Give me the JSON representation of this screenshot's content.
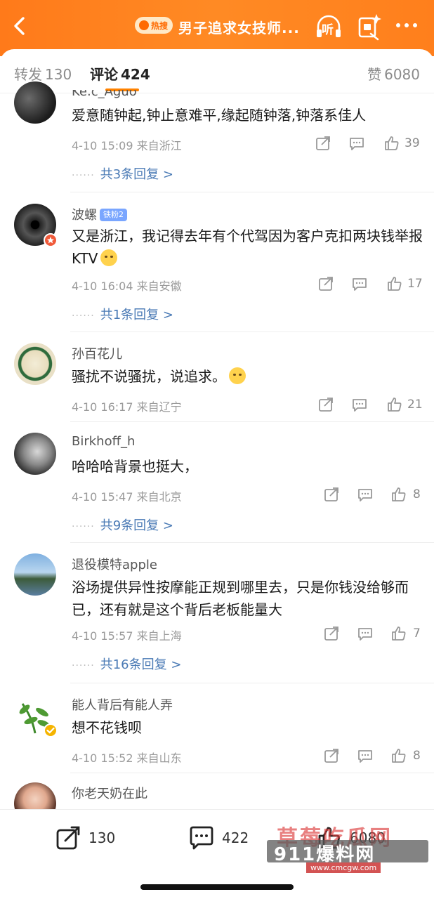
{
  "header": {
    "hot_badge": "热搜",
    "title": "男子追求女技师...",
    "listen_label": "听"
  },
  "tabs": {
    "repost_label": "转发",
    "repost_count": "130",
    "comments_label": "评论",
    "comments_count": "424",
    "likes_label": "赞",
    "likes_count": "6080"
  },
  "comments": [
    {
      "username": "Ke.c_Aguo",
      "text": "爱意随钟起,钟止意难平,缘起随钟落,钟落系佳人",
      "time": "4-10 15:09",
      "location": "来自浙江",
      "likes": "39",
      "replies": "共3条回复 >"
    },
    {
      "username": "波螺",
      "badge": "铁粉2",
      "text": "又是浙江，我记得去年有个代驾因为客户克扣两块钱举报KTV",
      "time": "4-10 16:04",
      "location": "来自安徽",
      "likes": "17",
      "replies": "共1条回复 >"
    },
    {
      "username": "孙百花儿",
      "text": "骚扰不说骚扰，说追求。",
      "time": "4-10 16:17",
      "location": "来自辽宁",
      "likes": "21"
    },
    {
      "username": "Birkhoff_h",
      "text": "哈哈哈背景也挺大，",
      "time": "4-10 15:47",
      "location": "来自北京",
      "likes": "8",
      "replies": "共9条回复 >"
    },
    {
      "username": "退役模特apple",
      "text": "浴场提供异性按摩能正规到哪里去，只是你钱没给够而已，还有就是这个背后老板能量大",
      "time": "4-10 15:57",
      "location": "来自上海",
      "likes": "7",
      "replies": "共16条回复 >"
    },
    {
      "username": "能人背后有能人弄",
      "text": "想不花钱呗",
      "time": "4-10 15:52",
      "location": "来自山东",
      "likes": "8"
    },
    {
      "username": "你老天奶在此"
    }
  ],
  "bottom": {
    "repost_count": "130",
    "comment_count": "422",
    "like_count": "6080"
  },
  "watermark": {
    "line1": "草莓吃瓜网",
    "line2": "911爆料网",
    "url": "www.cmcgw.com"
  },
  "colors": {
    "accent": "#ff8200",
    "reply_link": "#4a7ab5",
    "header": "#ff7a1a"
  }
}
